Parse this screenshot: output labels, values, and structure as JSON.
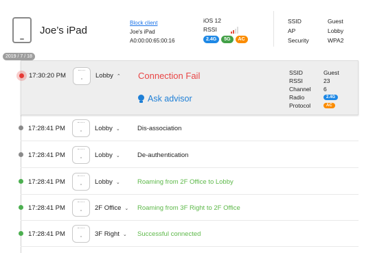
{
  "device": {
    "icon": "tablet-icon",
    "name": "Joe’s iPad"
  },
  "client": {
    "block_label": "Block client",
    "hostname": "Joe's iPad",
    "mac": "A0:00:00:65:00:16"
  },
  "os": {
    "version": "iOS 12",
    "rssi_label": "RSSI",
    "signal_icon": "signal-strength-icon",
    "tags": [
      {
        "label": "2.4G",
        "color": "#1e88e5"
      },
      {
        "label": "5G",
        "color": "#43a047"
      },
      {
        "label": "AC",
        "color": "#fb8c00"
      }
    ]
  },
  "network": {
    "rows": [
      {
        "label": "SSID",
        "value": "Guest"
      },
      {
        "label": "AP",
        "value": "Lobby"
      },
      {
        "label": "Security",
        "value": "WPA2"
      }
    ]
  },
  "timeline": {
    "date": "2019 / 7 / 18",
    "events": [
      {
        "time": "17:30:20 PM",
        "ap": "Lobby",
        "description": "Connection Fail",
        "status": "fail",
        "expanded": true,
        "advisor_label": "Ask advisor",
        "details": {
          "ssid_label": "SSID",
          "ssid": "Guest",
          "rssi_label": "RSSI",
          "rssi": "23",
          "channel_label": "Channel",
          "channel": "6",
          "radio_label": "Radio",
          "radio": "2.4G",
          "protocol_label": "Protocol",
          "protocol": "AC"
        }
      },
      {
        "time": "17:28:41 PM",
        "ap": "Lobby",
        "description": "Dis-association",
        "status": "neutral"
      },
      {
        "time": "17:28:41 PM",
        "ap": "Lobby",
        "description": "De-authentication",
        "status": "neutral"
      },
      {
        "time": "17:28:41 PM",
        "ap": "Lobby",
        "description": "Roaming from 2F Office to Lobby",
        "status": "success"
      },
      {
        "time": "17:28:41 PM",
        "ap": "2F Office",
        "description": "Roaming from 3F Right to 2F Office",
        "status": "success"
      },
      {
        "time": "17:28:41 PM",
        "ap": "3F Right",
        "description": "Successful connected",
        "status": "success"
      }
    ]
  },
  "colors": {
    "fail": "#e84545",
    "success": "#5cb848",
    "link": "#1a73e8",
    "advisor": "#1e7fd6"
  }
}
